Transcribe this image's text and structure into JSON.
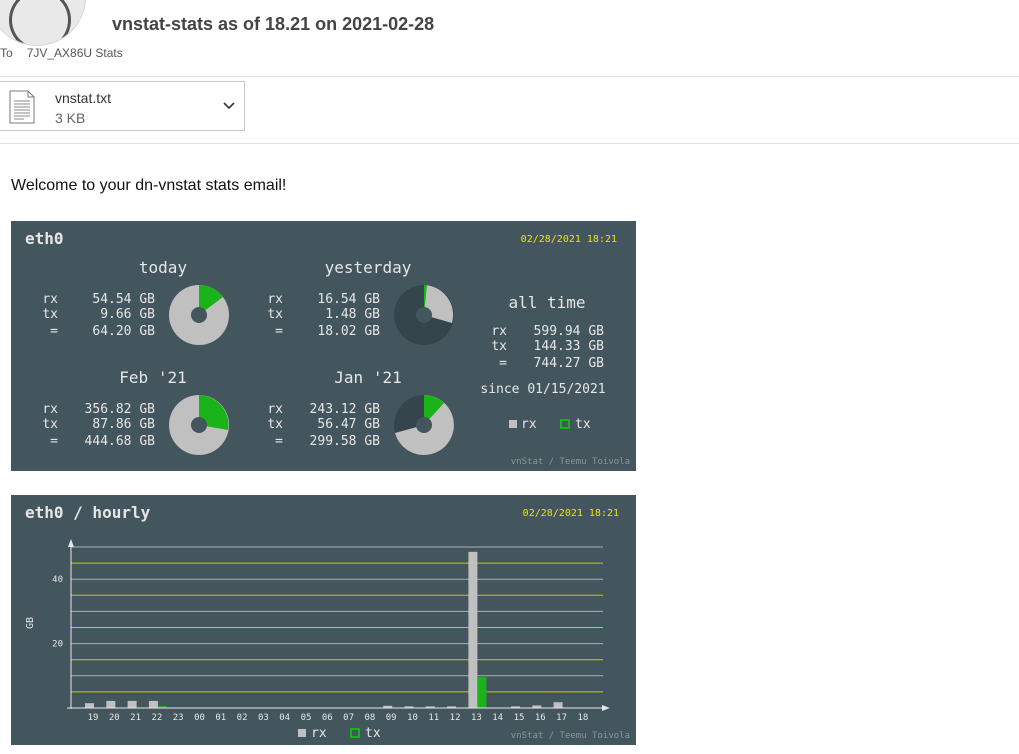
{
  "email": {
    "subject": "vnstat-stats as of 18.21 on 2021-02-28",
    "to_label": "To",
    "recipient": "7JV_AX86U Stats"
  },
  "attachment": {
    "filename": "vnstat.txt",
    "size": "3 KB"
  },
  "body": {
    "welcome": "Welcome to your dn-vnstat stats email!"
  },
  "summary": {
    "iface": "eth0",
    "timestamp": "02/28/2021 18:21",
    "footer": "vnStat / Teemu Toivola",
    "labels": {
      "rx": "rx",
      "tx": "tx",
      "total": "="
    },
    "periods": [
      {
        "title": "today",
        "rx": "54.54 GB",
        "tx": "9.66 GB",
        "total": "64.20 GB"
      },
      {
        "title": "yesterday",
        "rx": "16.54 GB",
        "tx": "1.48 GB",
        "total": "18.02 GB"
      },
      {
        "title": "Feb '21",
        "rx": "356.82 GB",
        "tx": "87.86 GB",
        "total": "444.68 GB"
      },
      {
        "title": "Jan '21",
        "rx": "243.12 GB",
        "tx": "56.47 GB",
        "total": "299.58 GB"
      }
    ],
    "alltime": {
      "title": "all time",
      "rx": "599.94 GB",
      "tx": "144.33 GB",
      "total": "744.27 GB",
      "since": "since 01/15/2021"
    },
    "legend": {
      "rx": "rx",
      "tx": "tx"
    }
  },
  "hourly": {
    "title": "eth0 / hourly",
    "timestamp": "02/28/2021 18:21",
    "footer": "vnStat / Teemu Toivola",
    "legend": {
      "rx": "rx",
      "tx": "tx"
    }
  },
  "colors": {
    "panel_bg": "#44565d",
    "text": "#e6e6e6",
    "timestamp": "#e8e800",
    "rx": "#c0c0c0",
    "tx": "#1ab31a",
    "gridline_major": "#c8c800",
    "gridline_minor": "#a8b0b2",
    "footer": "#8a9498"
  },
  "chart_data": {
    "type": "bar",
    "title": "eth0 / hourly",
    "ylabel": "GB",
    "ylim": [
      0,
      50
    ],
    "yticks": [
      "20",
      "40"
    ],
    "categories": [
      "19",
      "20",
      "21",
      "22",
      "23",
      "00",
      "01",
      "02",
      "03",
      "04",
      "05",
      "06",
      "07",
      "08",
      "09",
      "10",
      "11",
      "12",
      "13",
      "14",
      "15",
      "16",
      "17",
      "18"
    ],
    "series": [
      {
        "name": "rx",
        "values": [
          1.5,
          2.2,
          2.2,
          2.2,
          0,
          0,
          0,
          0,
          0,
          0,
          0,
          0,
          0,
          0,
          0.7,
          0.5,
          0.5,
          0.5,
          48.5,
          0,
          0.5,
          0.8,
          1.8,
          0
        ]
      },
      {
        "name": "tx",
        "values": [
          0,
          0,
          0,
          0.6,
          0,
          0,
          0,
          0,
          0,
          0,
          0,
          0,
          0,
          0,
          0,
          0,
          0,
          0,
          9.6,
          0,
          0,
          0,
          0,
          0
        ]
      }
    ],
    "grid": true,
    "legend": "bottom"
  }
}
